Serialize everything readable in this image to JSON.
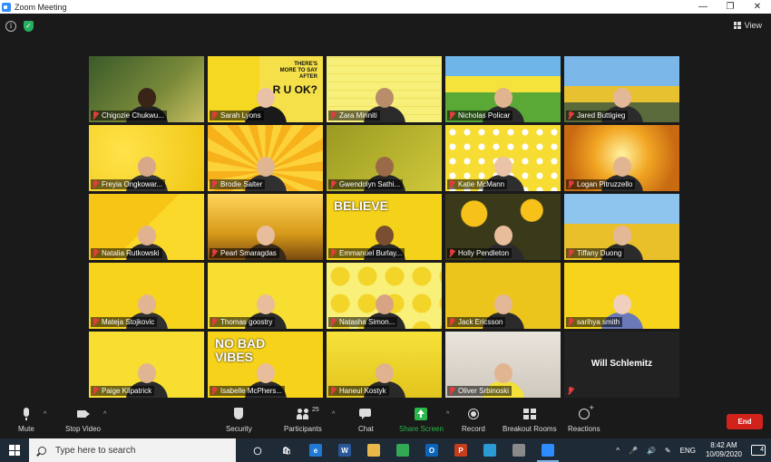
{
  "window": {
    "title": "Zoom Meeting",
    "controls": [
      "—",
      "❐",
      "✕"
    ]
  },
  "meeting": {
    "view_label": "View",
    "participants": [
      {
        "name": "Chigozie Chukwu...",
        "bg": "bg-jungle",
        "skin": "#3a2418",
        "shirt": "#222222"
      },
      {
        "name": "Sarah Lyons",
        "bg": "bg-slide",
        "skin": "#e9c1a6",
        "shirt": "#1a1a1a",
        "overlay_top": "THERE'S",
        "overlay_mid": "MORE TO SAY",
        "overlay_bot": "AFTER",
        "overlay_big": "R U OK?"
      },
      {
        "name": "Zara Minniti",
        "bg": "bg-check",
        "skin": "#b98c6a",
        "shirt": "#2a2a2a"
      },
      {
        "name": "Nicholas Policar",
        "bg": "bg-field",
        "skin": "#e0b48e",
        "shirt": "#2a2a2a"
      },
      {
        "name": "Jared Buttigieg",
        "bg": "bg-car",
        "skin": "#e3b897",
        "shirt": "#2b2b2b"
      },
      {
        "name": "Freyia Ongkowar...",
        "bg": "bg-hand",
        "skin": "#d8a888",
        "shirt": "#333333"
      },
      {
        "name": "Brodie Salter",
        "bg": "bg-rays",
        "skin": "#e2b592",
        "shirt": "#303030"
      },
      {
        "name": "Gwendolyn Sathi...",
        "bg": "bg-olive",
        "skin": "#9a6a48",
        "shirt": "#262626"
      },
      {
        "name": "Katie McMann",
        "bg": "bg-daisy",
        "skin": "#ebc4a8",
        "shirt": "#2e2e2e"
      },
      {
        "name": "Logan Pitruzzello",
        "bg": "bg-sunset",
        "skin": "#e2b592",
        "shirt": "#2a2a2a"
      },
      {
        "name": "Natalia Rutkowski",
        "bg": "bg-shapes",
        "skin": "#e0b290",
        "shirt": "#2b2b2b"
      },
      {
        "name": "Pearl Smaragdas",
        "bg": "bg-sunflower",
        "skin": "#e8bd9c",
        "shirt": "#3a2a1a"
      },
      {
        "name": "Emmanuel Burlay...",
        "bg": "bg-believe",
        "skin": "#7a4e30",
        "shirt": "#2a2a2a",
        "overlay_word": "BELIEVE"
      },
      {
        "name": "Holly Pendleton",
        "bg": "bg-flowers",
        "skin": "#e8bd9c",
        "shirt": "#2a2a2a"
      },
      {
        "name": "Tiffany Duong",
        "bg": "bg-flowerfield",
        "skin": "#e3b897",
        "shirt": "#2b2b2b"
      },
      {
        "name": "Mateja Stojkovic",
        "bg": "bg-plain",
        "skin": "#e2b592",
        "shirt": "#303030"
      },
      {
        "name": "Thomas goostry",
        "bg": "bg-plain2",
        "skin": "#e8bd9c",
        "shirt": "#2a2a2a"
      },
      {
        "name": "Natasha Simon...",
        "bg": "bg-dots",
        "skin": "#d6a482",
        "shirt": "#2a2a2a"
      },
      {
        "name": "Jack Ericsson",
        "bg": "bg-dark-yellow",
        "skin": "#e3b897",
        "shirt": "#2a2a2a"
      },
      {
        "name": "sarihya smith",
        "bg": "bg-plain",
        "skin": "#f0d0bc",
        "shirt": "#6a7ab8"
      },
      {
        "name": "Paige Kilpatrick",
        "bg": "bg-plain2",
        "skin": "#e2b592",
        "shirt": "#2a2a2a"
      },
      {
        "name": "Isabelle McPhers...",
        "bg": "bg-novibes",
        "skin": "#e8bd9c",
        "shirt": "#2a2a2a",
        "overlay_word": "NO BAD VIBES"
      },
      {
        "name": "Haneul Kostyk",
        "bg": "bg-figures",
        "skin": "#e0b290",
        "shirt": "#2a2a2a"
      },
      {
        "name": "Oliver Srbinoski",
        "bg": "bg-room",
        "skin": "#e2b592",
        "shirt": "#f3e03a"
      },
      {
        "name": "Will Schlemitz",
        "bg": "dark",
        "camera_off": true
      }
    ]
  },
  "toolbar": {
    "mute_label": "Mute",
    "stop_video_label": "Stop Video",
    "security_label": "Security",
    "participants_label": "Participants",
    "participants_count": "25",
    "chat_label": "Chat",
    "share_screen_label": "Share Screen",
    "record_label": "Record",
    "breakout_label": "Breakout Rooms",
    "reactions_label": "Reactions",
    "end_label": "End",
    "share_color": "#2ab84a",
    "end_color": "#d1221b"
  },
  "taskbar": {
    "search_placeholder": "Type here to search",
    "apps": [
      {
        "name": "task-view",
        "label": "◯",
        "color": "transparent"
      },
      {
        "name": "store",
        "label": "🛍",
        "color": "transparent"
      },
      {
        "name": "edge",
        "label": "e",
        "color": "#1f7ad6"
      },
      {
        "name": "word",
        "label": "W",
        "color": "#2b579a"
      },
      {
        "name": "file-explorer",
        "label": "",
        "color": "#e8b84a"
      },
      {
        "name": "chrome",
        "label": "",
        "color": "#34a853"
      },
      {
        "name": "outlook",
        "label": "O",
        "color": "#0a64b8"
      },
      {
        "name": "powerpoint",
        "label": "P",
        "color": "#c43e1c"
      },
      {
        "name": "app-teal",
        "label": "",
        "color": "#2b9bd6"
      },
      {
        "name": "app-gear",
        "label": "",
        "color": "#8a8a8a"
      },
      {
        "name": "zoom",
        "label": "",
        "color": "#2d8cff"
      }
    ],
    "language": "ENG",
    "time": "8:42 AM",
    "date": "10/09/2020",
    "notification_count": "4"
  }
}
